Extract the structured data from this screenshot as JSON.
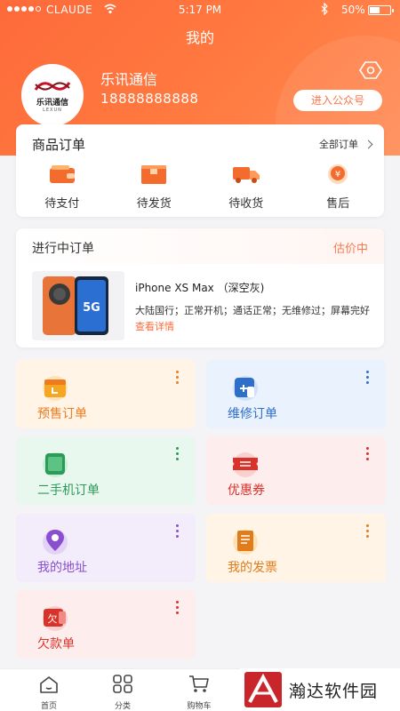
{
  "status_bar": {
    "carrier": "CLAUDE",
    "time": "5:17 PM",
    "battery": "50%",
    "battery_level": 0.5
  },
  "header": {
    "title": "我的",
    "user_name": "乐讯通信",
    "phone": "18888888888",
    "official_account_label": "进入公众号",
    "logo": {
      "cn": "乐讯通信",
      "en": "LEXUN"
    }
  },
  "orders": {
    "title": "商品订单",
    "all_label": "全部订单",
    "items": [
      {
        "label": "待支付",
        "icon": "wallet-icon"
      },
      {
        "label": "待发货",
        "icon": "box-icon"
      },
      {
        "label": "待收货",
        "icon": "truck-icon"
      },
      {
        "label": "售后",
        "icon": "after-sale-icon"
      }
    ]
  },
  "ongoing": {
    "title": "进行中订单",
    "status": "估价中",
    "product_name": "iPhone XS Max （深空灰)",
    "product_desc": "大陆国行；正常开机；通话正常；无维修过；屏幕完好",
    "link": "查看详情",
    "thumb_badge": "5G"
  },
  "tiles": [
    {
      "label": "预售订单",
      "icon": "calendar-icon",
      "color": "#f07a1e",
      "bg": "#fff4e6"
    },
    {
      "label": "维修订单",
      "icon": "wrench-icon",
      "color": "#2e6fc9",
      "bg": "#eaf2fd"
    },
    {
      "label": "二手机订单",
      "icon": "phone-icon",
      "color": "#2c9a59",
      "bg": "#e9f8ee"
    },
    {
      "label": "优惠券",
      "icon": "coupon-icon",
      "color": "#d9322a",
      "bg": "#fdeeed"
    },
    {
      "label": "我的地址",
      "icon": "location-icon",
      "color": "#8a4fd0",
      "bg": "#f2ecfb"
    },
    {
      "label": "我的发票",
      "icon": "invoice-icon",
      "color": "#e27c1b",
      "bg": "#fff4e6"
    },
    {
      "label": "欠款单",
      "icon": "debt-icon",
      "color": "#d9322a",
      "bg": "#fdeeed"
    }
  ],
  "bottom_nav": [
    {
      "label": "首页",
      "icon": "home-icon"
    },
    {
      "label": "分类",
      "icon": "category-icon"
    },
    {
      "label": "购物车",
      "icon": "cart-icon"
    }
  ],
  "watermark": {
    "text": "瀚达软件园"
  }
}
